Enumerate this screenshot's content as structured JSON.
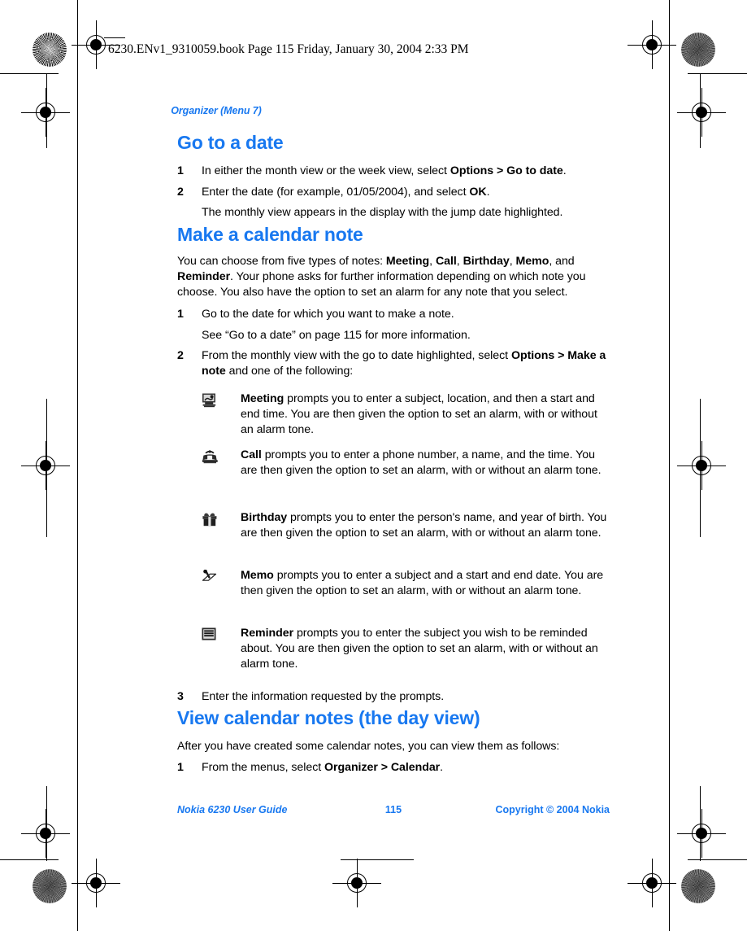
{
  "header": {
    "file_info": "6230.ENv1_9310059.book  Page 115  Friday, January 30, 2004  2:33 PM"
  },
  "running_head": "Organizer (Menu 7)",
  "sections": [
    {
      "heading": "Go to a date",
      "steps": [
        {
          "num": "1",
          "text_before": "In either the month view or the week view, select ",
          "bold": "Options > Go to date",
          "text_after": "."
        },
        {
          "num": "2",
          "text_before": "Enter the date (for example, 01/05/2004), and select ",
          "bold": "OK",
          "text_after": "."
        }
      ],
      "continuation": "The monthly view appears in the display with the jump date highlighted."
    },
    {
      "heading": "Make a calendar note",
      "intro_part1": "You can choose from five types of notes: ",
      "intro_bold1": "Meeting",
      "intro_part2": ", ",
      "intro_bold2": "Call",
      "intro_part3": ", ",
      "intro_bold3": "Birthday",
      "intro_part4": ", ",
      "intro_bold4": "Memo",
      "intro_part5": ", and ",
      "intro_bold5": "Reminder",
      "intro_part6": ". Your phone asks for further information depending on which note you choose. You also have the option to set an alarm for any note that you select.",
      "step1_num": "1",
      "step1_text": "Go to the date for which you want to make a note.",
      "step1_cont": "See “Go to a date” on page 115 for more information.",
      "step2_num": "2",
      "step2_before": "From the monthly view with the go to date highlighted, select ",
      "step2_bold1": "Options >",
      "step2_mid": " ",
      "step2_bold2": "Make a note",
      "step2_after": " and one of the following:",
      "note_types": [
        {
          "icon": "meeting-icon",
          "label": "Meeting",
          "description": " prompts you to enter a subject, location, and then a start and end time. You are then given the option to set an alarm, with or without an alarm tone."
        },
        {
          "icon": "telephone-icon",
          "label": "Call",
          "description": " prompts you to enter a phone number, a name, and the time. You are then given the option to set an alarm, with or without an alarm tone."
        },
        {
          "icon": "gift-icon",
          "label": "Birthday",
          "description": " prompts you to enter the person's name, and year of birth. You are then given the option to set an alarm, with or without an alarm tone."
        },
        {
          "icon": "pen-note-icon",
          "label": "Memo",
          "description": " prompts you to enter a subject and a start and end date. You are then given the option to set an alarm, with or without an alarm tone."
        },
        {
          "icon": "lines-list-icon",
          "label": "Reminder",
          "description": " prompts you to enter the subject you wish to be reminded about. You are then given the option to set an alarm, with or without an alarm tone."
        }
      ],
      "step3_num": "3",
      "step3_text": "Enter the information requested by the prompts."
    },
    {
      "heading": "View calendar notes (the day view)",
      "intro": "After you have created some calendar notes, you can view them as follows:",
      "step1_num": "1",
      "step1_before": "From the menus, select ",
      "step1_bold": "Organizer > Calendar",
      "step1_after": "."
    }
  ],
  "footer": {
    "left": "Nokia 6230 User Guide",
    "center": "115",
    "right": "Copyright © 2004 Nokia"
  },
  "colors": {
    "accent_blue": "#1878f0",
    "text_black": "#000000",
    "page_white": "#ffffff"
  }
}
